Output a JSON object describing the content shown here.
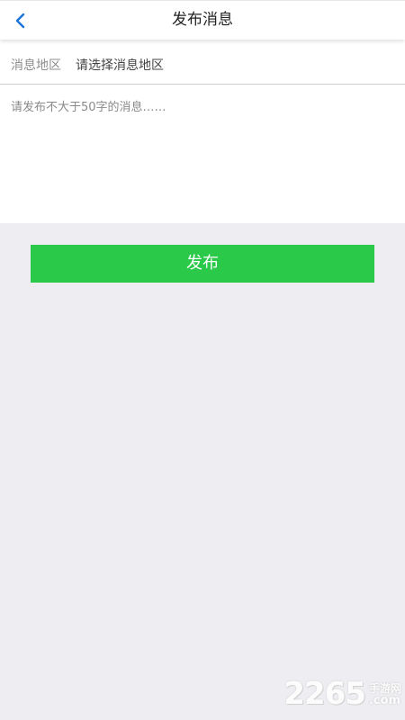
{
  "header": {
    "title": "发布消息",
    "back_icon": "chevron-left-icon"
  },
  "form": {
    "region_label": "消息地区",
    "region_value": "请选择消息地区",
    "message_placeholder": "请发布不大于50字的消息……",
    "message_value": ""
  },
  "actions": {
    "publish_label": "发布"
  },
  "watermark": {
    "digits": "2265",
    "cn": "手游网",
    "suffix": ".com"
  },
  "colors": {
    "accent": "#2ac94a",
    "back_icon": "#1a73d9",
    "page_background": "#eeeef2"
  }
}
